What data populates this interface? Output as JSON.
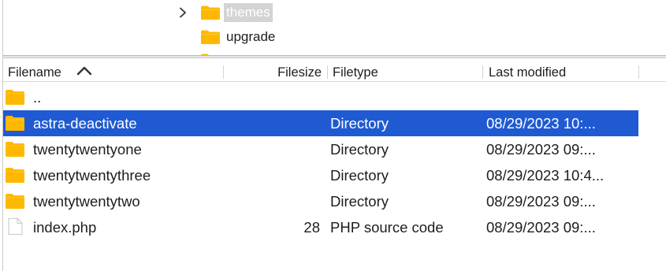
{
  "tree": {
    "items": [
      {
        "label": "themes",
        "expanded": false,
        "selected": true
      },
      {
        "label": "upgrade",
        "expanded": false,
        "selected": false
      }
    ]
  },
  "list": {
    "columns": {
      "filename": "Filename",
      "filesize": "Filesize",
      "filetype": "Filetype",
      "last_modified": "Last modified"
    },
    "sort": {
      "column": "Filename",
      "direction": "ascending"
    },
    "rows": [
      {
        "icon": "folder-icon",
        "name": "..",
        "size": "",
        "type": "",
        "modified": "",
        "selected": false
      },
      {
        "icon": "folder-icon",
        "name": "astra-deactivate",
        "size": "",
        "type": "Directory",
        "modified": "08/29/2023 10:...",
        "selected": true
      },
      {
        "icon": "folder-icon",
        "name": "twentytwentyone",
        "size": "",
        "type": "Directory",
        "modified": "08/29/2023 09:...",
        "selected": false
      },
      {
        "icon": "folder-icon",
        "name": "twentytwentythree",
        "size": "",
        "type": "Directory",
        "modified": "08/29/2023 10:4...",
        "selected": false
      },
      {
        "icon": "folder-icon",
        "name": "twentytwentytwo",
        "size": "",
        "type": "Directory",
        "modified": "08/29/2023 09:...",
        "selected": false
      },
      {
        "icon": "file-icon",
        "name": "index.php",
        "size": "28",
        "type": "PHP source code",
        "modified": "08/29/2023 09:...",
        "selected": false
      }
    ]
  },
  "colors": {
    "folder": "#ffb800",
    "selection": "#1f5ad3",
    "tree_selection": "#d4d4d4"
  }
}
